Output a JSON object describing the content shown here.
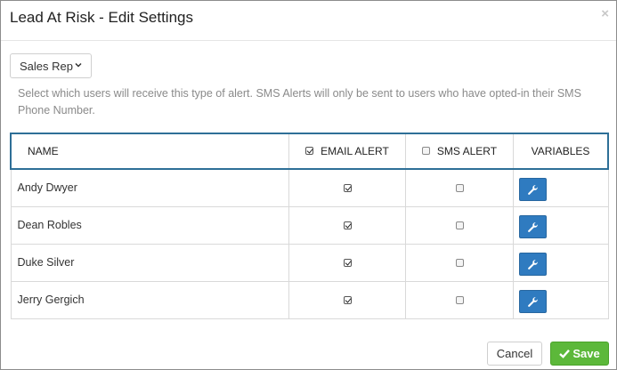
{
  "dialog": {
    "title": "Lead At Risk - Edit Settings",
    "close_label": "×"
  },
  "role_select": {
    "value": "Sales Rep"
  },
  "help_text": "Select which users will receive this type of alert. SMS Alerts will only be sent to users who have opted-in their SMS Phone Number.",
  "table": {
    "headers": {
      "name": "NAME",
      "email": "EMAIL ALERT",
      "email_checked": true,
      "sms": "SMS ALERT",
      "sms_checked": false,
      "variables": "VARIABLES"
    },
    "rows": [
      {
        "name": "Andy Dwyer",
        "email": true,
        "sms": false
      },
      {
        "name": "Dean Robles",
        "email": true,
        "sms": false
      },
      {
        "name": "Duke Silver",
        "email": true,
        "sms": false
      },
      {
        "name": "Jerry Gergich",
        "email": true,
        "sms": false
      }
    ]
  },
  "footer": {
    "cancel_label": "Cancel",
    "save_label": "Save"
  },
  "icons": {
    "variables_button": "wrench-icon",
    "save": "check-icon",
    "dropdown": "chevron-down-icon"
  },
  "colors": {
    "header_border": "#2e6f97",
    "variables_button": "#2f7bc0",
    "save_button": "#5cb83a"
  }
}
